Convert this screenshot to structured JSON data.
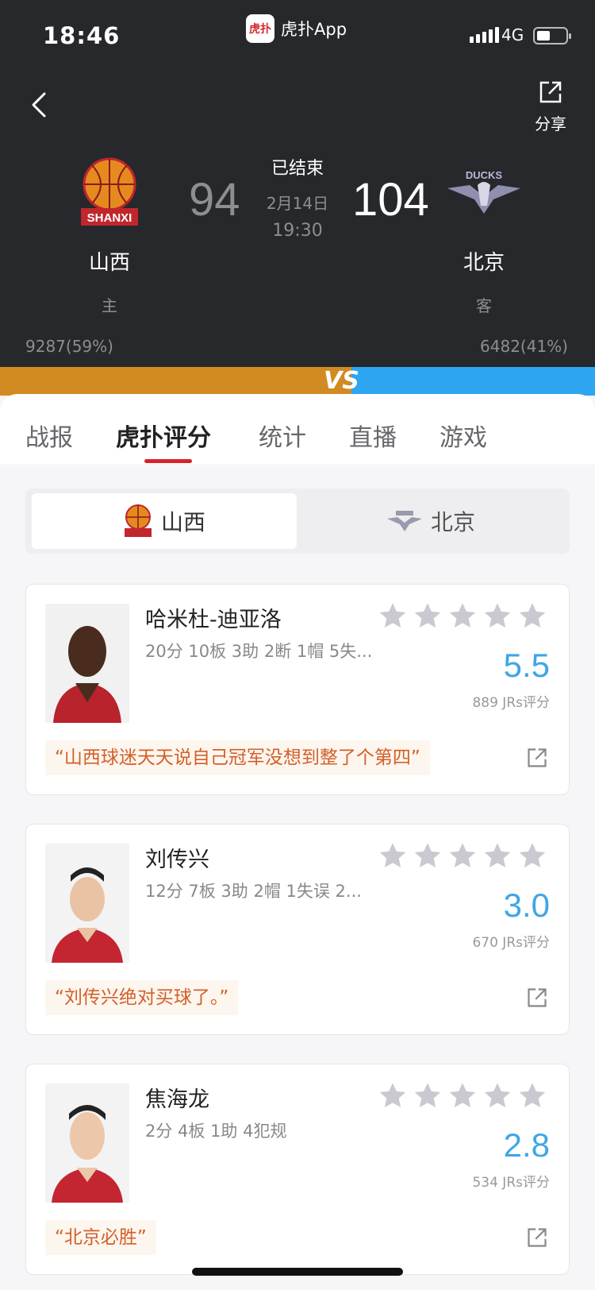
{
  "status_bar": {
    "time": "18:46",
    "app_name": "虎扑App",
    "app_logo_text": "虎扑",
    "network": "4G"
  },
  "header": {
    "share_label": "分享",
    "game_status": "已结束",
    "game_date": "2月14日",
    "game_time": "19:30",
    "home": {
      "name": "山西",
      "role": "主",
      "score": "94",
      "support": "9287(59%)",
      "logo_text": "SHANXI"
    },
    "away": {
      "name": "北京",
      "role": "客",
      "score": "104",
      "support": "6482(41%)",
      "logo_text": "DUCKS"
    },
    "vs_text": "VS",
    "support_home_fraction": 0.59
  },
  "tabs": [
    {
      "label": "战报",
      "active": false
    },
    {
      "label": "虎扑评分",
      "active": true
    },
    {
      "label": "统计",
      "active": false
    },
    {
      "label": "直播",
      "active": false
    },
    {
      "label": "游戏",
      "active": false
    }
  ],
  "team_switch": {
    "home_label": "山西",
    "away_label": "北京",
    "selected": "home"
  },
  "players": [
    {
      "name": "哈米杜-迪亚洛",
      "stats": "20分 10板 3助 2断 1帽 5失...",
      "rating": "5.5",
      "votes": "889 JRs评分",
      "comment": "“山西球迷天天说自己冠军没想到整了个第四”"
    },
    {
      "name": "刘传兴",
      "stats": "12分 7板 3助 2帽 1失误 2...",
      "rating": "3.0",
      "votes": "670 JRs评分",
      "comment": "“刘传兴绝对买球了。”"
    },
    {
      "name": "焦海龙",
      "stats": "2分 4板 1助 4犯规",
      "rating": "2.8",
      "votes": "534 JRs评分",
      "comment": "“北京必胜”"
    }
  ],
  "colors": {
    "accent_red": "#d8222c",
    "rating_blue": "#3ea6e6",
    "home_orange": "#d28a22",
    "away_blue": "#2ea5f0",
    "comment_orange": "#d2602a"
  }
}
